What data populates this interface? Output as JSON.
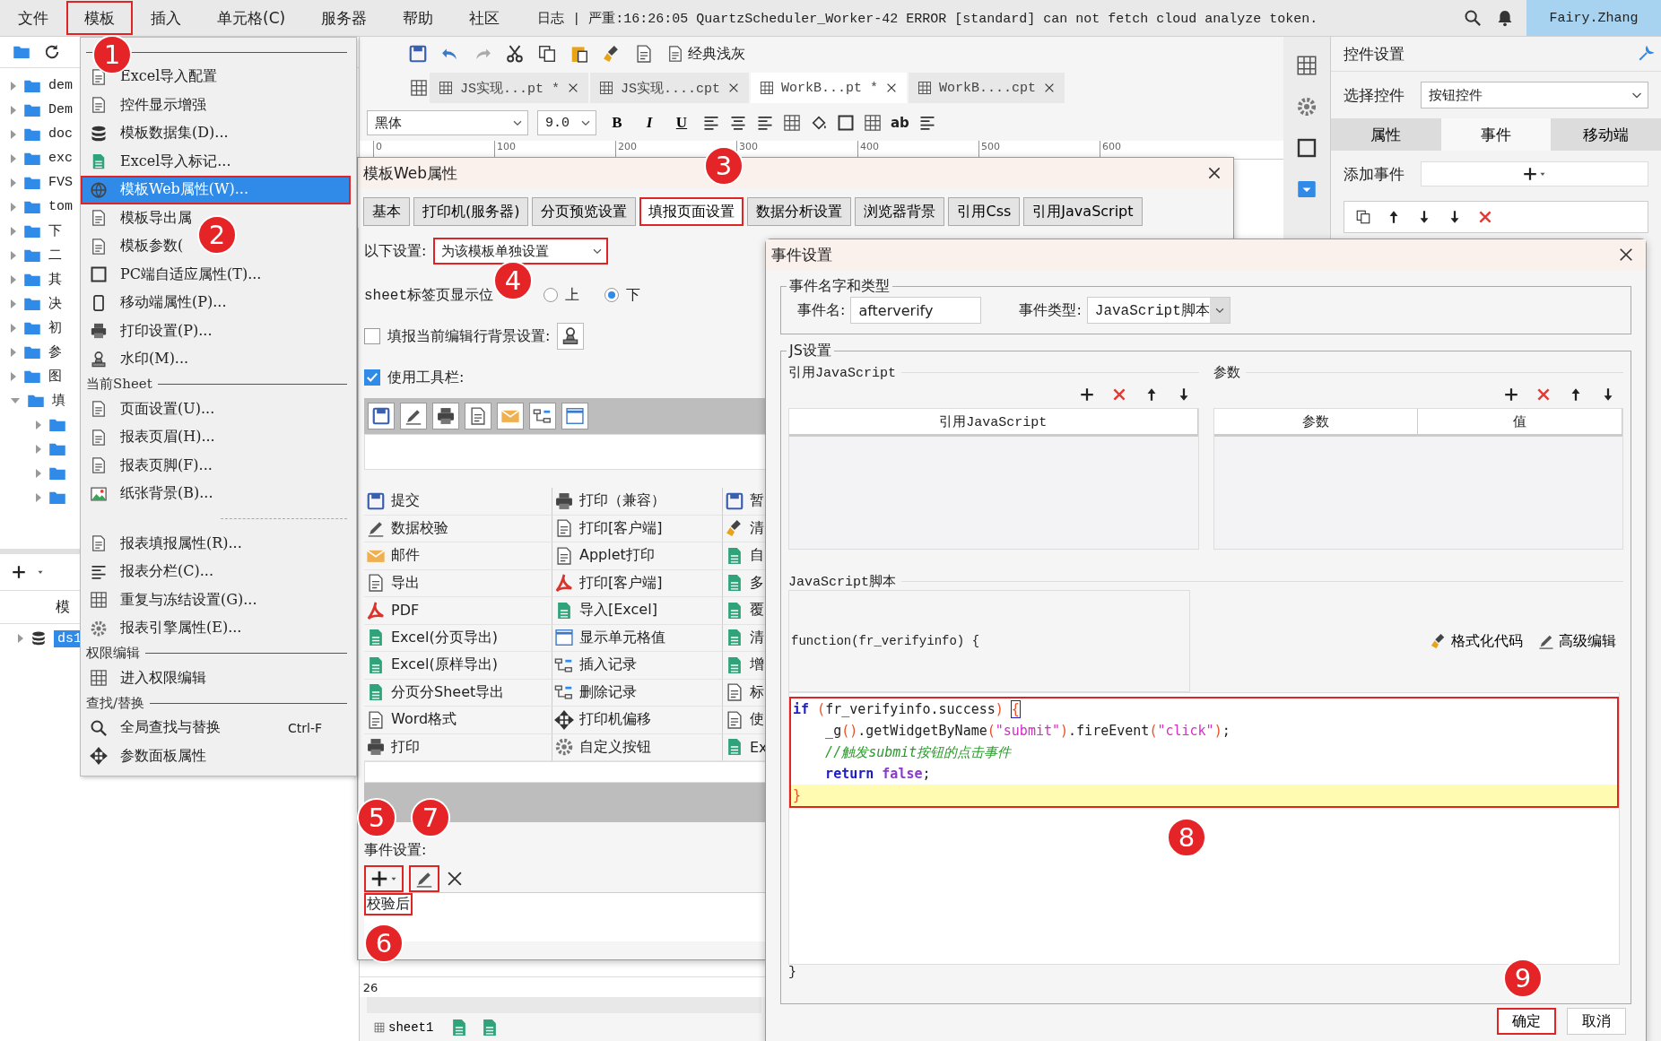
{
  "menubar": {
    "items": [
      {
        "label": "文件",
        "highlighted": false
      },
      {
        "label": "模板",
        "highlighted": true
      },
      {
        "label": "插入",
        "highlighted": false
      },
      {
        "label": "单元格(C)",
        "highlighted": false
      },
      {
        "label": "服务器",
        "highlighted": false
      },
      {
        "label": "帮助",
        "highlighted": false
      },
      {
        "label": "社区",
        "highlighted": false
      }
    ],
    "log": "日志 | 严重:16:26:05 QuartzScheduler_Worker-42 ERROR [standard] can not fetch cloud analyze token.",
    "user": "Fairy.Zhang"
  },
  "sidebar": {
    "tree": [
      {
        "name": "dem",
        "expanded": false
      },
      {
        "name": "Dem",
        "expanded": false
      },
      {
        "name": "doc",
        "expanded": false
      },
      {
        "name": "exc",
        "expanded": false
      },
      {
        "name": "FVS",
        "expanded": false
      },
      {
        "name": "tom",
        "expanded": false
      },
      {
        "name": "下",
        "expanded": false
      },
      {
        "name": "二",
        "expanded": false
      },
      {
        "name": "其",
        "expanded": false
      },
      {
        "name": "决",
        "expanded": false
      },
      {
        "name": "初",
        "expanded": false
      },
      {
        "name": "参",
        "expanded": false
      },
      {
        "name": "图",
        "expanded": false
      },
      {
        "name": "填",
        "expanded": true,
        "children": [
          {
            "expanded": false
          },
          {
            "expanded": false
          },
          {
            "expanded": false
          },
          {
            "expanded": false
          }
        ]
      }
    ],
    "datasets_header": "模",
    "datasets": [
      {
        "name": "ds1",
        "selected": true
      }
    ]
  },
  "template_menu": {
    "sections": [
      {
        "items": [
          {
            "label": "Excel导入配置",
            "selected": false,
            "highlighted": false
          },
          {
            "label": "控件显示增强",
            "selected": false,
            "highlighted": false
          },
          {
            "label": "模板数据集(D)...",
            "selected": false,
            "highlighted": false
          },
          {
            "label": "Excel导入标记...",
            "selected": false,
            "highlighted": false
          },
          {
            "label": "模板Web属性(W)...",
            "selected": true,
            "highlighted": true
          },
          {
            "label": "模板导出属",
            "selected": false,
            "highlighted": false
          },
          {
            "label": "模板参数(",
            "selected": false,
            "highlighted": false
          },
          {
            "label": "PC端自适应属性(T)...",
            "selected": false,
            "highlighted": false
          },
          {
            "label": "移动端属性(P)...",
            "selected": false,
            "highlighted": false
          },
          {
            "label": "打印设置(P)...",
            "selected": false,
            "highlighted": false
          },
          {
            "label": "水印(M)...",
            "selected": false,
            "highlighted": false
          }
        ]
      },
      {
        "header": "当前Sheet",
        "items": [
          {
            "label": "页面设置(U)...",
            "selected": false,
            "highlighted": false
          },
          {
            "label": "报表页眉(H)...",
            "selected": false,
            "highlighted": false
          },
          {
            "label": "报表页脚(F)...",
            "selected": false,
            "highlighted": false
          },
          {
            "label": "纸张背景(B)...",
            "selected": false,
            "highlighted": false
          }
        ]
      },
      {
        "items": [
          {
            "label": "报表填报属性(R)...",
            "selected": false,
            "highlighted": false
          },
          {
            "label": "报表分栏(C)...",
            "selected": false,
            "highlighted": false
          },
          {
            "label": "重复与冻结设置(G)...",
            "selected": false,
            "highlighted": false
          },
          {
            "label": "报表引擎属性(E)...",
            "selected": false,
            "highlighted": false
          }
        ]
      },
      {
        "header": "权限编辑",
        "items": [
          {
            "label": "进入权限编辑",
            "selected": false,
            "highlighted": false
          }
        ]
      },
      {
        "header": "查找/替换",
        "items": [
          {
            "label": "全局查找与替换",
            "shortcut": "Ctrl-F",
            "selected": false,
            "highlighted": false
          },
          {
            "label": "参数面板属性",
            "selected": false,
            "highlighted": false
          }
        ]
      }
    ]
  },
  "toolbar": {
    "theme_label": "经典浅灰",
    "tabs": [
      {
        "label": "JS实现...pt *",
        "selected": false
      },
      {
        "label": "JS实现....cpt",
        "selected": false
      },
      {
        "label": "WorkB...pt *",
        "selected": true
      },
      {
        "label": "WorkB....cpt",
        "selected": false
      }
    ],
    "font": "黑体",
    "font_size": "9.0",
    "format_buttons": [
      "B",
      "I",
      "U"
    ],
    "ab_label": "ab",
    "ruler": [
      "0",
      "100",
      "200",
      "300",
      "400",
      "500",
      "600"
    ]
  },
  "sheet": {
    "row_number": "26",
    "sheet_tab": "sheet1"
  },
  "right_panel": {
    "title": "控件设置",
    "select_label": "选择控件",
    "select_value": "按钮控件",
    "tabs": [
      {
        "label": "属性",
        "selected": false
      },
      {
        "label": "事件",
        "selected": true
      },
      {
        "label": "移动端",
        "selected": false
      }
    ],
    "add_event_label": "添加事件"
  },
  "web_dialog": {
    "title": "模板Web属性",
    "tabs": [
      {
        "label": "基本",
        "selected": false,
        "highlighted": false
      },
      {
        "label": "打印机(服务器)",
        "selected": false,
        "highlighted": false
      },
      {
        "label": "分页预览设置",
        "selected": false,
        "highlighted": false
      },
      {
        "label": "填报页面设置",
        "selected": true,
        "highlighted": true
      },
      {
        "label": "数据分析设置",
        "selected": false,
        "highlighted": false
      },
      {
        "label": "浏览器背景",
        "selected": false,
        "highlighted": false
      },
      {
        "label": "引用Css",
        "selected": false,
        "highlighted": false
      },
      {
        "label": "引用JavaScript",
        "selected": false,
        "highlighted": false
      }
    ],
    "scope_label": "以下设置:",
    "scope_value": "为该模板单独设置",
    "scope_highlighted": true,
    "sheet_tab_label": "sheet标签页显示位",
    "positions": [
      {
        "label": "上",
        "selected": false
      },
      {
        "label": "下",
        "selected": true
      }
    ],
    "row_bg": {
      "label": "填报当前编辑行背景设置:",
      "checked": false
    },
    "use_toolbar": {
      "label": "使用工具栏:",
      "checked": true
    },
    "button_rows": [
      [
        "提交",
        "打印（兼容）",
        "暂"
      ],
      [
        "数据校验",
        "打印[客户端]",
        "清"
      ],
      [
        "邮件",
        "Applet打印",
        "自"
      ],
      [
        "导出",
        "打印[客户端]",
        "多"
      ],
      [
        "PDF",
        "导入[Excel]",
        "覆"
      ],
      [
        "Excel(分页导出)",
        "显示单元格值",
        "清"
      ],
      [
        "Excel(原样导出)",
        "插入记录",
        "增"
      ],
      [
        "分页分Sheet导出",
        "删除记录",
        "标"
      ],
      [
        "Word格式",
        "打印机偏移",
        "使"
      ],
      [
        "打印",
        "自定义按钮",
        "Ex"
      ]
    ],
    "event_label": "事件设置:",
    "add_highlighted": true,
    "edit_highlighted": true,
    "events": [
      {
        "label": "校验后",
        "highlighted": true
      }
    ]
  },
  "event_dialog": {
    "title": "事件设置",
    "name_group": "事件名字和类型",
    "name_label": "事件名:",
    "name_value": "afterverify",
    "type_label": "事件类型:",
    "type_value": "JavaScript脚本",
    "js_group": "JS设置",
    "ref_title": "引用JavaScript",
    "ref_columns": [
      "引用JavaScript"
    ],
    "param_title": "参数",
    "param_columns": [
      "参数",
      "值"
    ],
    "script_title": "JavaScript脚本",
    "function_header": "function(fr_verifyinfo) {",
    "format_code": "格式化代码",
    "advanced_edit": "高级编辑",
    "code_highlighted": true,
    "code_lines": [
      {
        "current": false,
        "tokens": [
          {
            "kind": "keyword",
            "text": "if"
          },
          {
            "kind": "paren",
            "text": " ("
          },
          {
            "kind": "plain",
            "text": "fr_verifyinfo.success"
          },
          {
            "kind": "paren",
            "text": ") "
          },
          {
            "kind": "match",
            "text": "{"
          }
        ]
      },
      {
        "current": false,
        "tokens": [
          {
            "kind": "plain",
            "text": "    _g"
          },
          {
            "kind": "paren",
            "text": "()"
          },
          {
            "kind": "plain",
            "text": ".getWidgetByName"
          },
          {
            "kind": "paren",
            "text": "("
          },
          {
            "kind": "string",
            "text": "\"submit\""
          },
          {
            "kind": "paren",
            "text": ")"
          },
          {
            "kind": "plain",
            "text": ".fireEvent"
          },
          {
            "kind": "paren",
            "text": "("
          },
          {
            "kind": "string",
            "text": "\"click\""
          },
          {
            "kind": "paren",
            "text": ")"
          },
          {
            "kind": "plain",
            "text": ";"
          }
        ]
      },
      {
        "current": false,
        "tokens": [
          {
            "kind": "comment",
            "text": "    //触发submit按钮的点击事件"
          }
        ]
      },
      {
        "current": false,
        "tokens": [
          {
            "kind": "keyword",
            "text": "    return"
          },
          {
            "kind": "literal",
            "text": " false"
          },
          {
            "kind": "plain",
            "text": ";"
          }
        ]
      },
      {
        "current": true,
        "tokens": [
          {
            "kind": "paren",
            "text": "}"
          }
        ]
      }
    ],
    "closing": "}",
    "ok": {
      "label": "确定",
      "highlighted": true
    },
    "cancel": "取消"
  },
  "callouts": [
    "1",
    "2",
    "3",
    "4",
    "5",
    "6",
    "7",
    "8",
    "9"
  ]
}
